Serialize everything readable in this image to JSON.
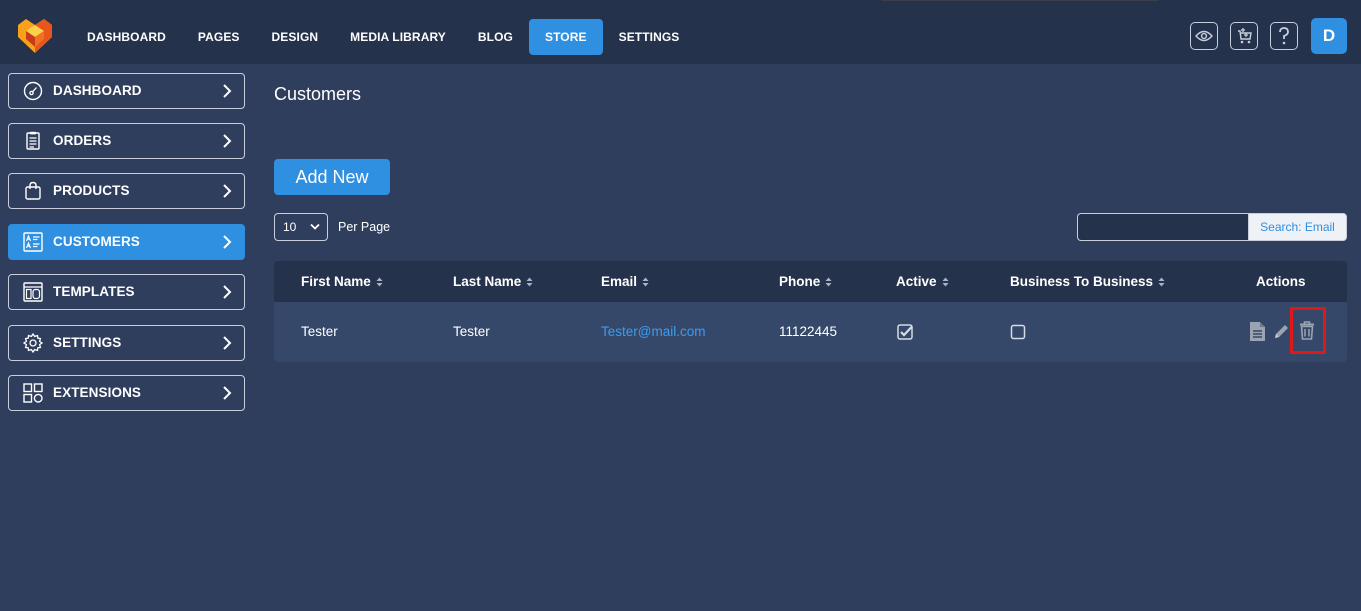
{
  "topnav": {
    "items": [
      {
        "label": "DASHBOARD",
        "active": false
      },
      {
        "label": "PAGES",
        "active": false
      },
      {
        "label": "DESIGN",
        "active": false
      },
      {
        "label": "MEDIA LIBRARY",
        "active": false
      },
      {
        "label": "BLOG",
        "active": false
      },
      {
        "label": "STORE",
        "active": true
      },
      {
        "label": "SETTINGS",
        "active": false
      }
    ],
    "icons": [
      "eye-icon",
      "cart-add-icon",
      "help-icon"
    ],
    "avatar": "D"
  },
  "sidebar": {
    "items": [
      {
        "label": "DASHBOARD",
        "icon": "gauge-icon",
        "active": false
      },
      {
        "label": "ORDERS",
        "icon": "receipt-icon",
        "active": false
      },
      {
        "label": "PRODUCTS",
        "icon": "bag-icon",
        "active": false
      },
      {
        "label": "CUSTOMERS",
        "icon": "customer-card-icon",
        "active": true
      },
      {
        "label": "TEMPLATES",
        "icon": "template-icon",
        "active": false
      },
      {
        "label": "SETTINGS",
        "icon": "gear-icon",
        "active": false
      },
      {
        "label": "EXTENSIONS",
        "icon": "grid-icon",
        "active": false
      }
    ]
  },
  "main": {
    "title": "Customers",
    "add_button": "Add New",
    "per_page": {
      "value": "10",
      "label": "Per Page"
    },
    "search": {
      "value": "",
      "button": "Search: Email"
    },
    "table": {
      "headers": [
        "First Name",
        "Last Name",
        "Email",
        "Phone",
        "Active",
        "Business To Business",
        "Actions"
      ],
      "rows": [
        {
          "first_name": "Tester",
          "last_name": "Tester",
          "email": "Tester@mail.com",
          "phone": "11122445",
          "active": true,
          "b2b": false
        }
      ]
    }
  },
  "colors": {
    "accent": "#2f8fe0",
    "background": "#2f3e5c",
    "topbar": "#25324b",
    "highlight": "#e01818"
  }
}
